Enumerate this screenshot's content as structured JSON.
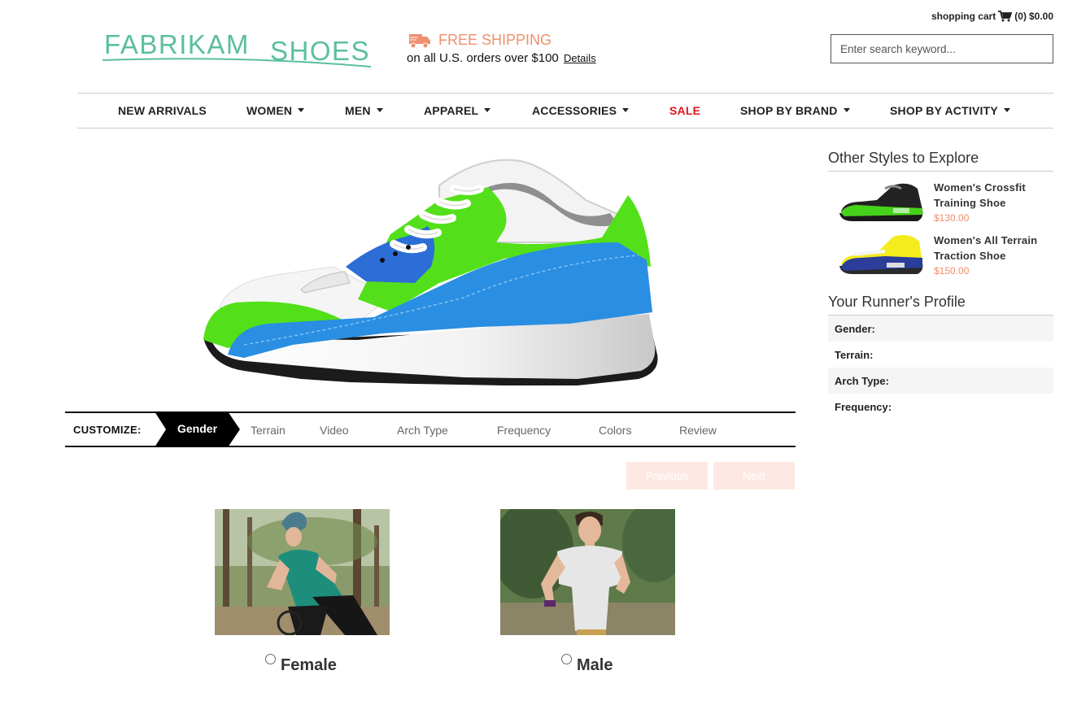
{
  "brand": {
    "name_part1": "FABRIKAM",
    "name_part2": "SHOES",
    "accent": "#5bbf9c"
  },
  "shipping": {
    "title": "FREE SHIPPING",
    "subtitle": "on all U.S. orders over $100",
    "details_link": "Details",
    "accent": "#f08e6e",
    "icon": "truck-icon"
  },
  "cart": {
    "label": "shopping cart",
    "count": "(0)",
    "total": "$0.00",
    "icon": "cart-icon"
  },
  "search": {
    "placeholder": "Enter search keyword..."
  },
  "nav": {
    "items": [
      {
        "label": "NEW ARRIVALS",
        "dropdown": false
      },
      {
        "label": "WOMEN",
        "dropdown": true
      },
      {
        "label": "MEN",
        "dropdown": true
      },
      {
        "label": "APPAREL",
        "dropdown": true
      },
      {
        "label": "ACCESSORIES",
        "dropdown": true
      },
      {
        "label": "SALE",
        "dropdown": false,
        "color": "#e0141c"
      },
      {
        "label": "SHOP BY BRAND",
        "dropdown": true
      },
      {
        "label": "SHOP BY ACTIVITY",
        "dropdown": true
      }
    ]
  },
  "customize": {
    "label": "CUSTOMIZE:",
    "steps": [
      "Gender",
      "Terrain",
      "Video",
      "Arch Type",
      "Frequency",
      "Colors",
      "Review"
    ],
    "active_step": "Gender",
    "previous_label": "Previous",
    "next_label": "Next"
  },
  "gender": {
    "options": [
      {
        "label": "Female",
        "selected": false
      },
      {
        "label": "Male",
        "selected": false
      }
    ]
  },
  "sidebar": {
    "other_styles_title": "Other Styles to Explore",
    "products": [
      {
        "name": "Women's Crossfit Training Shoe",
        "price": "$130.00"
      },
      {
        "name": "Women's All Terrain Traction Shoe",
        "price": "$150.00"
      }
    ],
    "profile_title": "Your Runner's Profile",
    "profile_fields": [
      "Gender:",
      "Terrain:",
      "Arch Type:",
      "Frequency:"
    ]
  }
}
